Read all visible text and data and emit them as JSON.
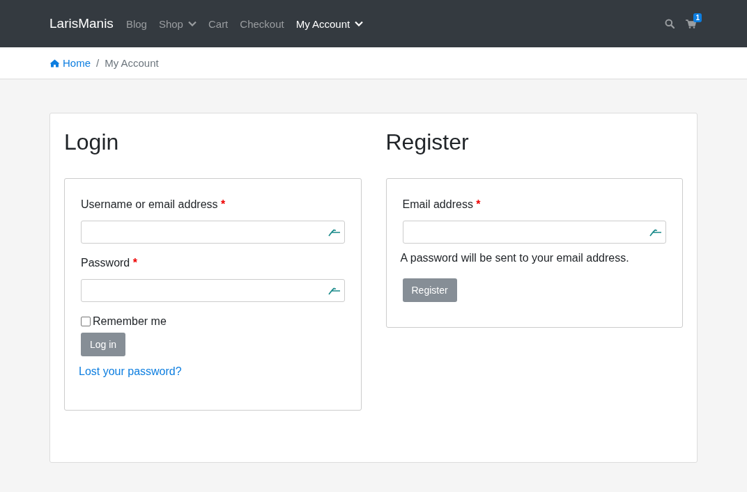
{
  "navbar": {
    "brand": "LarisManis",
    "items": [
      {
        "label": "Blog",
        "selected": false,
        "dropdown": false
      },
      {
        "label": "Shop",
        "selected": false,
        "dropdown": true
      },
      {
        "label": "Cart",
        "selected": false,
        "dropdown": false
      },
      {
        "label": "Checkout",
        "selected": false,
        "dropdown": false
      },
      {
        "label": "My Account",
        "selected": true,
        "dropdown": true
      }
    ],
    "cart_count": "1"
  },
  "breadcrumb": {
    "separator": "/",
    "items": [
      {
        "label": "Home",
        "link": true
      },
      {
        "label": "My Account",
        "link": false
      }
    ]
  },
  "login": {
    "title": "Login",
    "fields": [
      {
        "label": "Username or email address",
        "required_mark": "*"
      },
      {
        "label": "Password",
        "required_mark": "*"
      }
    ],
    "remember": {
      "label": "Remember me",
      "checked": false
    },
    "button": "Log in",
    "lost_link": "Lost your password?"
  },
  "register": {
    "title": "Register",
    "fields": [
      {
        "label": "Email address",
        "required_mark": "*"
      }
    ],
    "note": "A password will be sent to your email address.",
    "button": "Register"
  }
}
